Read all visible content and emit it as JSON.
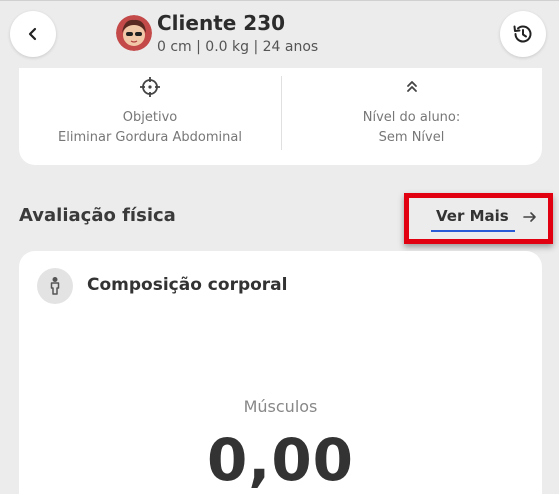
{
  "header": {
    "client_name": "Cliente 230",
    "stats": "0 cm | 0.0 kg | 24 anos",
    "back_icon": "chevron-left-icon",
    "history_icon": "history-icon"
  },
  "info_card": {
    "objective": {
      "icon": "crosshair-icon",
      "label": "Objetivo",
      "value": "Eliminar Gordura Abdominal"
    },
    "level": {
      "icon": "double-chevron-up-icon",
      "label": "Nível do aluno:",
      "value": "Sem Nível"
    }
  },
  "evaluation": {
    "title": "Avaliação física",
    "see_more_label": "Ver Mais",
    "see_more_icon": "arrow-right-icon",
    "highlight_color": "#e0000f",
    "underline_color": "#2a5bd7"
  },
  "composition_card": {
    "icon": "person-icon",
    "title": "Composição corporal",
    "metric_label": "Músculos",
    "metric_value": "0,00"
  }
}
